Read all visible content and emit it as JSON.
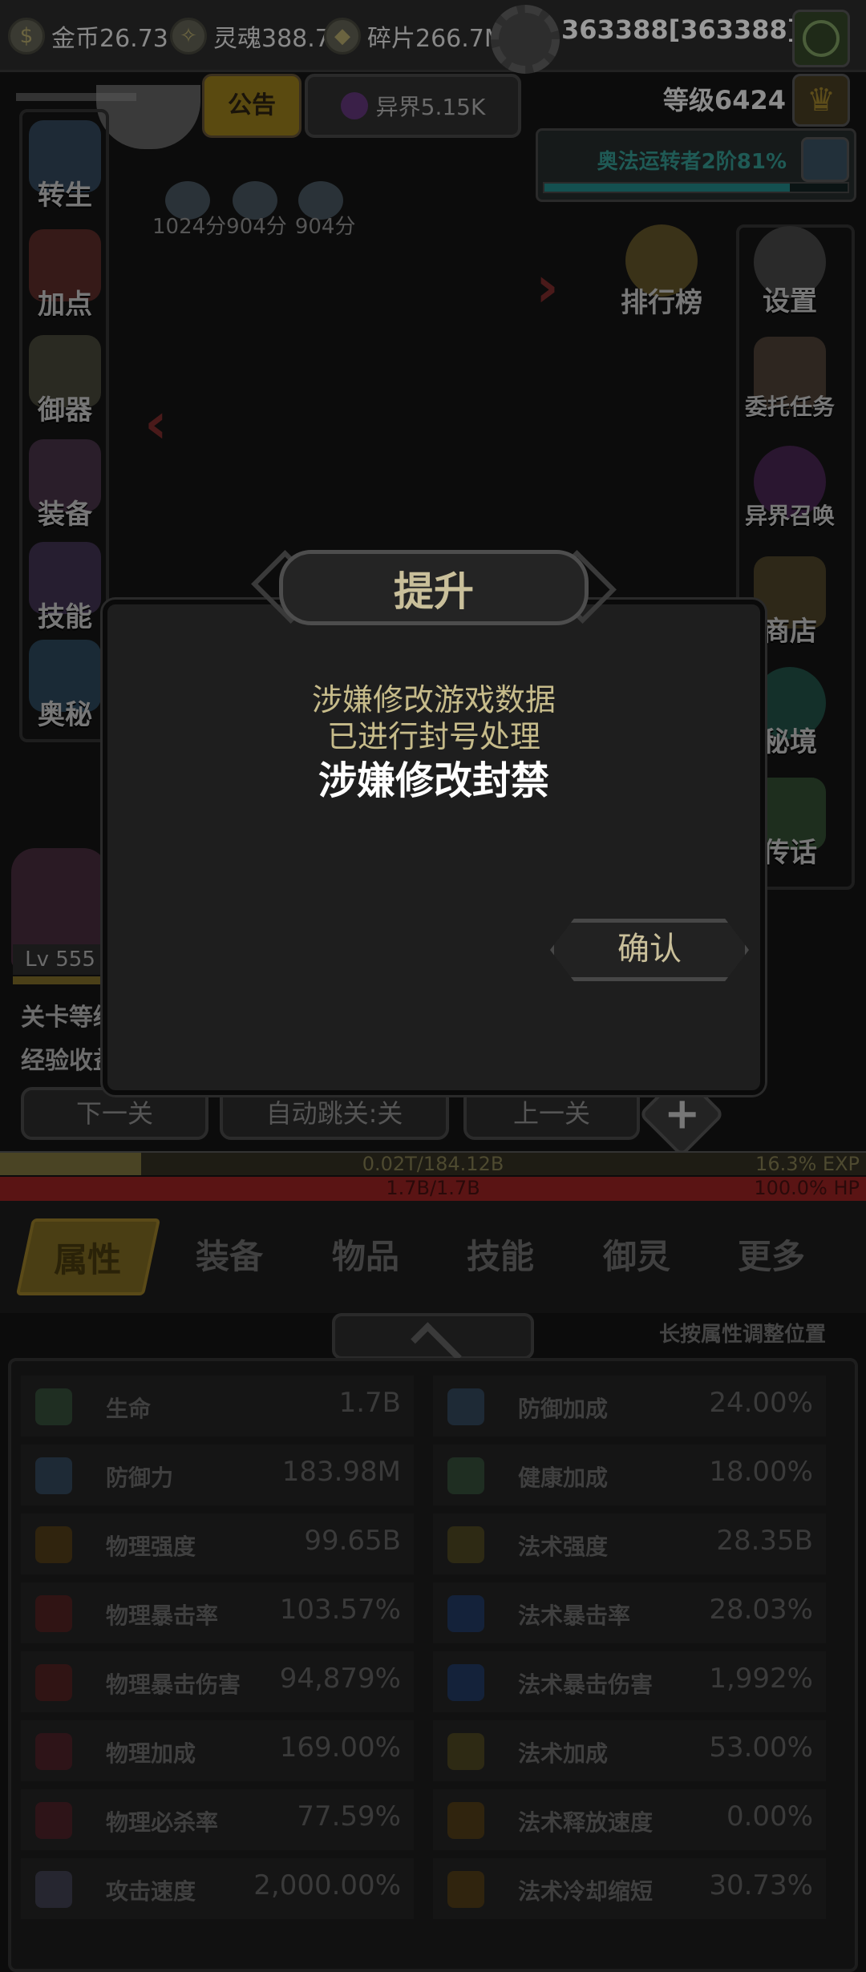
{
  "topbar": {
    "gold": "金币26.73",
    "soul": "灵魂388.7",
    "shard": "碎片266.7M",
    "player_id": "363388[363388]",
    "level": "等级6424",
    "arcane_label": "奥法运转者2阶81%",
    "arcane_progress": 0.81
  },
  "notice": {
    "announce": "公告",
    "otherworld": "异界5.15K"
  },
  "left_menu": [
    "转生",
    "加点",
    "御器",
    "装备",
    "技能",
    "奥秘"
  ],
  "right_menu": [
    "设置",
    "委托任务",
    "异界召唤",
    "商店",
    "秘境",
    "传话"
  ],
  "ranking": "排行榜",
  "mini_scores": [
    "1024分",
    "904分",
    "904分"
  ],
  "boss": {
    "level": "Lv 555"
  },
  "stage": {
    "level_label": "关卡等级",
    "exp_label": "经验收益"
  },
  "nav": {
    "next": "下一关",
    "auto": "自动跳关:关",
    "prev": "上一关",
    "plus": "+"
  },
  "exp_bar": {
    "value": "0.02T/184.12B",
    "percent": "16.3% EXP",
    "fill": 0.163
  },
  "hp_bar": {
    "value": "1.7B/1.7B",
    "percent": "100.0%  HP"
  },
  "tabs": [
    "属性",
    "装备",
    "物品",
    "技能",
    "御灵",
    "更多"
  ],
  "hint": "长按属性调整位置",
  "stats_left": [
    {
      "name": "生命",
      "value": "1.7B"
    },
    {
      "name": "防御力",
      "value": "183.98M"
    },
    {
      "name": "物理强度",
      "value": "99.65B"
    },
    {
      "name": "物理暴击率",
      "value": "103.57%"
    },
    {
      "name": "物理暴击伤害",
      "value": "94,879%"
    },
    {
      "name": "物理加成",
      "value": "169.00%"
    },
    {
      "name": "物理必杀率",
      "value": "77.59%"
    },
    {
      "name": "攻击速度",
      "value": "2,000.00%"
    }
  ],
  "stats_right": [
    {
      "name": "防御加成",
      "value": "24.00%"
    },
    {
      "name": "健康加成",
      "value": "18.00%"
    },
    {
      "name": "法术强度",
      "value": "28.35B"
    },
    {
      "name": "法术暴击率",
      "value": "28.03%"
    },
    {
      "name": "法术暴击伤害",
      "value": "1,992%"
    },
    {
      "name": "法术加成",
      "value": "53.00%"
    },
    {
      "name": "法术释放速度",
      "value": "0.00%"
    },
    {
      "name": "法术冷却缩短",
      "value": "30.73%"
    }
  ],
  "dialog": {
    "title": "提升",
    "line1": "涉嫌修改游戏数据",
    "line2": "已进行封号处理",
    "line3": "涉嫌修改封禁",
    "confirm": "确认"
  }
}
